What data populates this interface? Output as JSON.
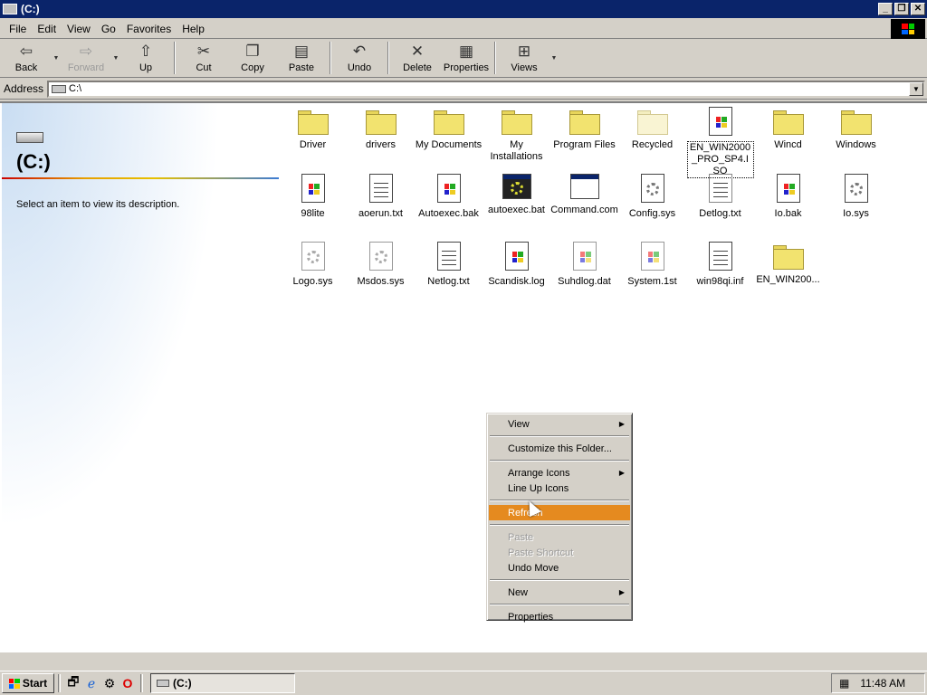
{
  "window": {
    "title": "(C:)"
  },
  "menus": [
    "File",
    "Edit",
    "View",
    "Go",
    "Favorites",
    "Help"
  ],
  "toolbar": {
    "back": "Back",
    "forward": "Forward",
    "up": "Up",
    "cut": "Cut",
    "copy": "Copy",
    "paste": "Paste",
    "undo": "Undo",
    "delete": "Delete",
    "properties": "Properties",
    "views": "Views"
  },
  "address": {
    "label": "Address",
    "value": "C:\\"
  },
  "leftpane": {
    "title": "(C:)",
    "description": "Select an item to view its description."
  },
  "files": [
    {
      "name": "Driver",
      "icon": "folder-icon"
    },
    {
      "name": "drivers",
      "icon": "folder-icon"
    },
    {
      "name": "My Documents",
      "icon": "folder-icon"
    },
    {
      "name": "My Installations",
      "icon": "folder-icon"
    },
    {
      "name": "Program Files",
      "icon": "folder-icon"
    },
    {
      "name": "Recycled",
      "icon": "recycled-folder-icon"
    },
    {
      "name": "EN_WIN2000_PRO_SP4.ISO",
      "icon": "iso-file-icon"
    },
    {
      "name": "Wincd",
      "icon": "folder-icon"
    },
    {
      "name": "Windows",
      "icon": "folder-icon"
    },
    {
      "name": "98lite",
      "icon": "windows-file-icon"
    },
    {
      "name": "aoerun.txt",
      "icon": "text-file-icon"
    },
    {
      "name": "Autoexec.bak",
      "icon": "windows-file-icon"
    },
    {
      "name": "autoexec.bat",
      "icon": "batch-file-icon"
    },
    {
      "name": "Command.com",
      "icon": "application-icon"
    },
    {
      "name": "Config.sys",
      "icon": "system-file-icon"
    },
    {
      "name": "Detlog.txt",
      "icon": "text-file-icon"
    },
    {
      "name": "Io.bak",
      "icon": "windows-file-icon"
    },
    {
      "name": "Io.sys",
      "icon": "system-file-icon"
    },
    {
      "name": "Logo.sys",
      "icon": "system-file-icon"
    },
    {
      "name": "Msdos.sys",
      "icon": "system-file-icon"
    },
    {
      "name": "Netlog.txt",
      "icon": "text-file-icon"
    },
    {
      "name": "Scandisk.log",
      "icon": "windows-file-icon"
    },
    {
      "name": "Suhdlog.dat",
      "icon": "windows-file-icon"
    },
    {
      "name": "System.1st",
      "icon": "windows-file-icon"
    },
    {
      "name": "win98qi.inf",
      "icon": "setup-info-file-icon"
    },
    {
      "name": "EN_WIN200...",
      "icon": "folder-icon"
    }
  ],
  "context_menu": {
    "view": "View",
    "customize": "Customize this Folder...",
    "arrange": "Arrange Icons",
    "lineup": "Line Up Icons",
    "refresh": "Refresh",
    "paste": "Paste",
    "paste_shortcut": "Paste Shortcut",
    "undo_move": "Undo Move",
    "new": "New",
    "properties": "Properties"
  },
  "taskbar": {
    "start": "Start",
    "task": "(C:)",
    "clock": "11:48 AM"
  },
  "colors": {
    "titlebar": "#0a246a",
    "highlight": "#e58a1f",
    "folder": "#f2e36f"
  }
}
